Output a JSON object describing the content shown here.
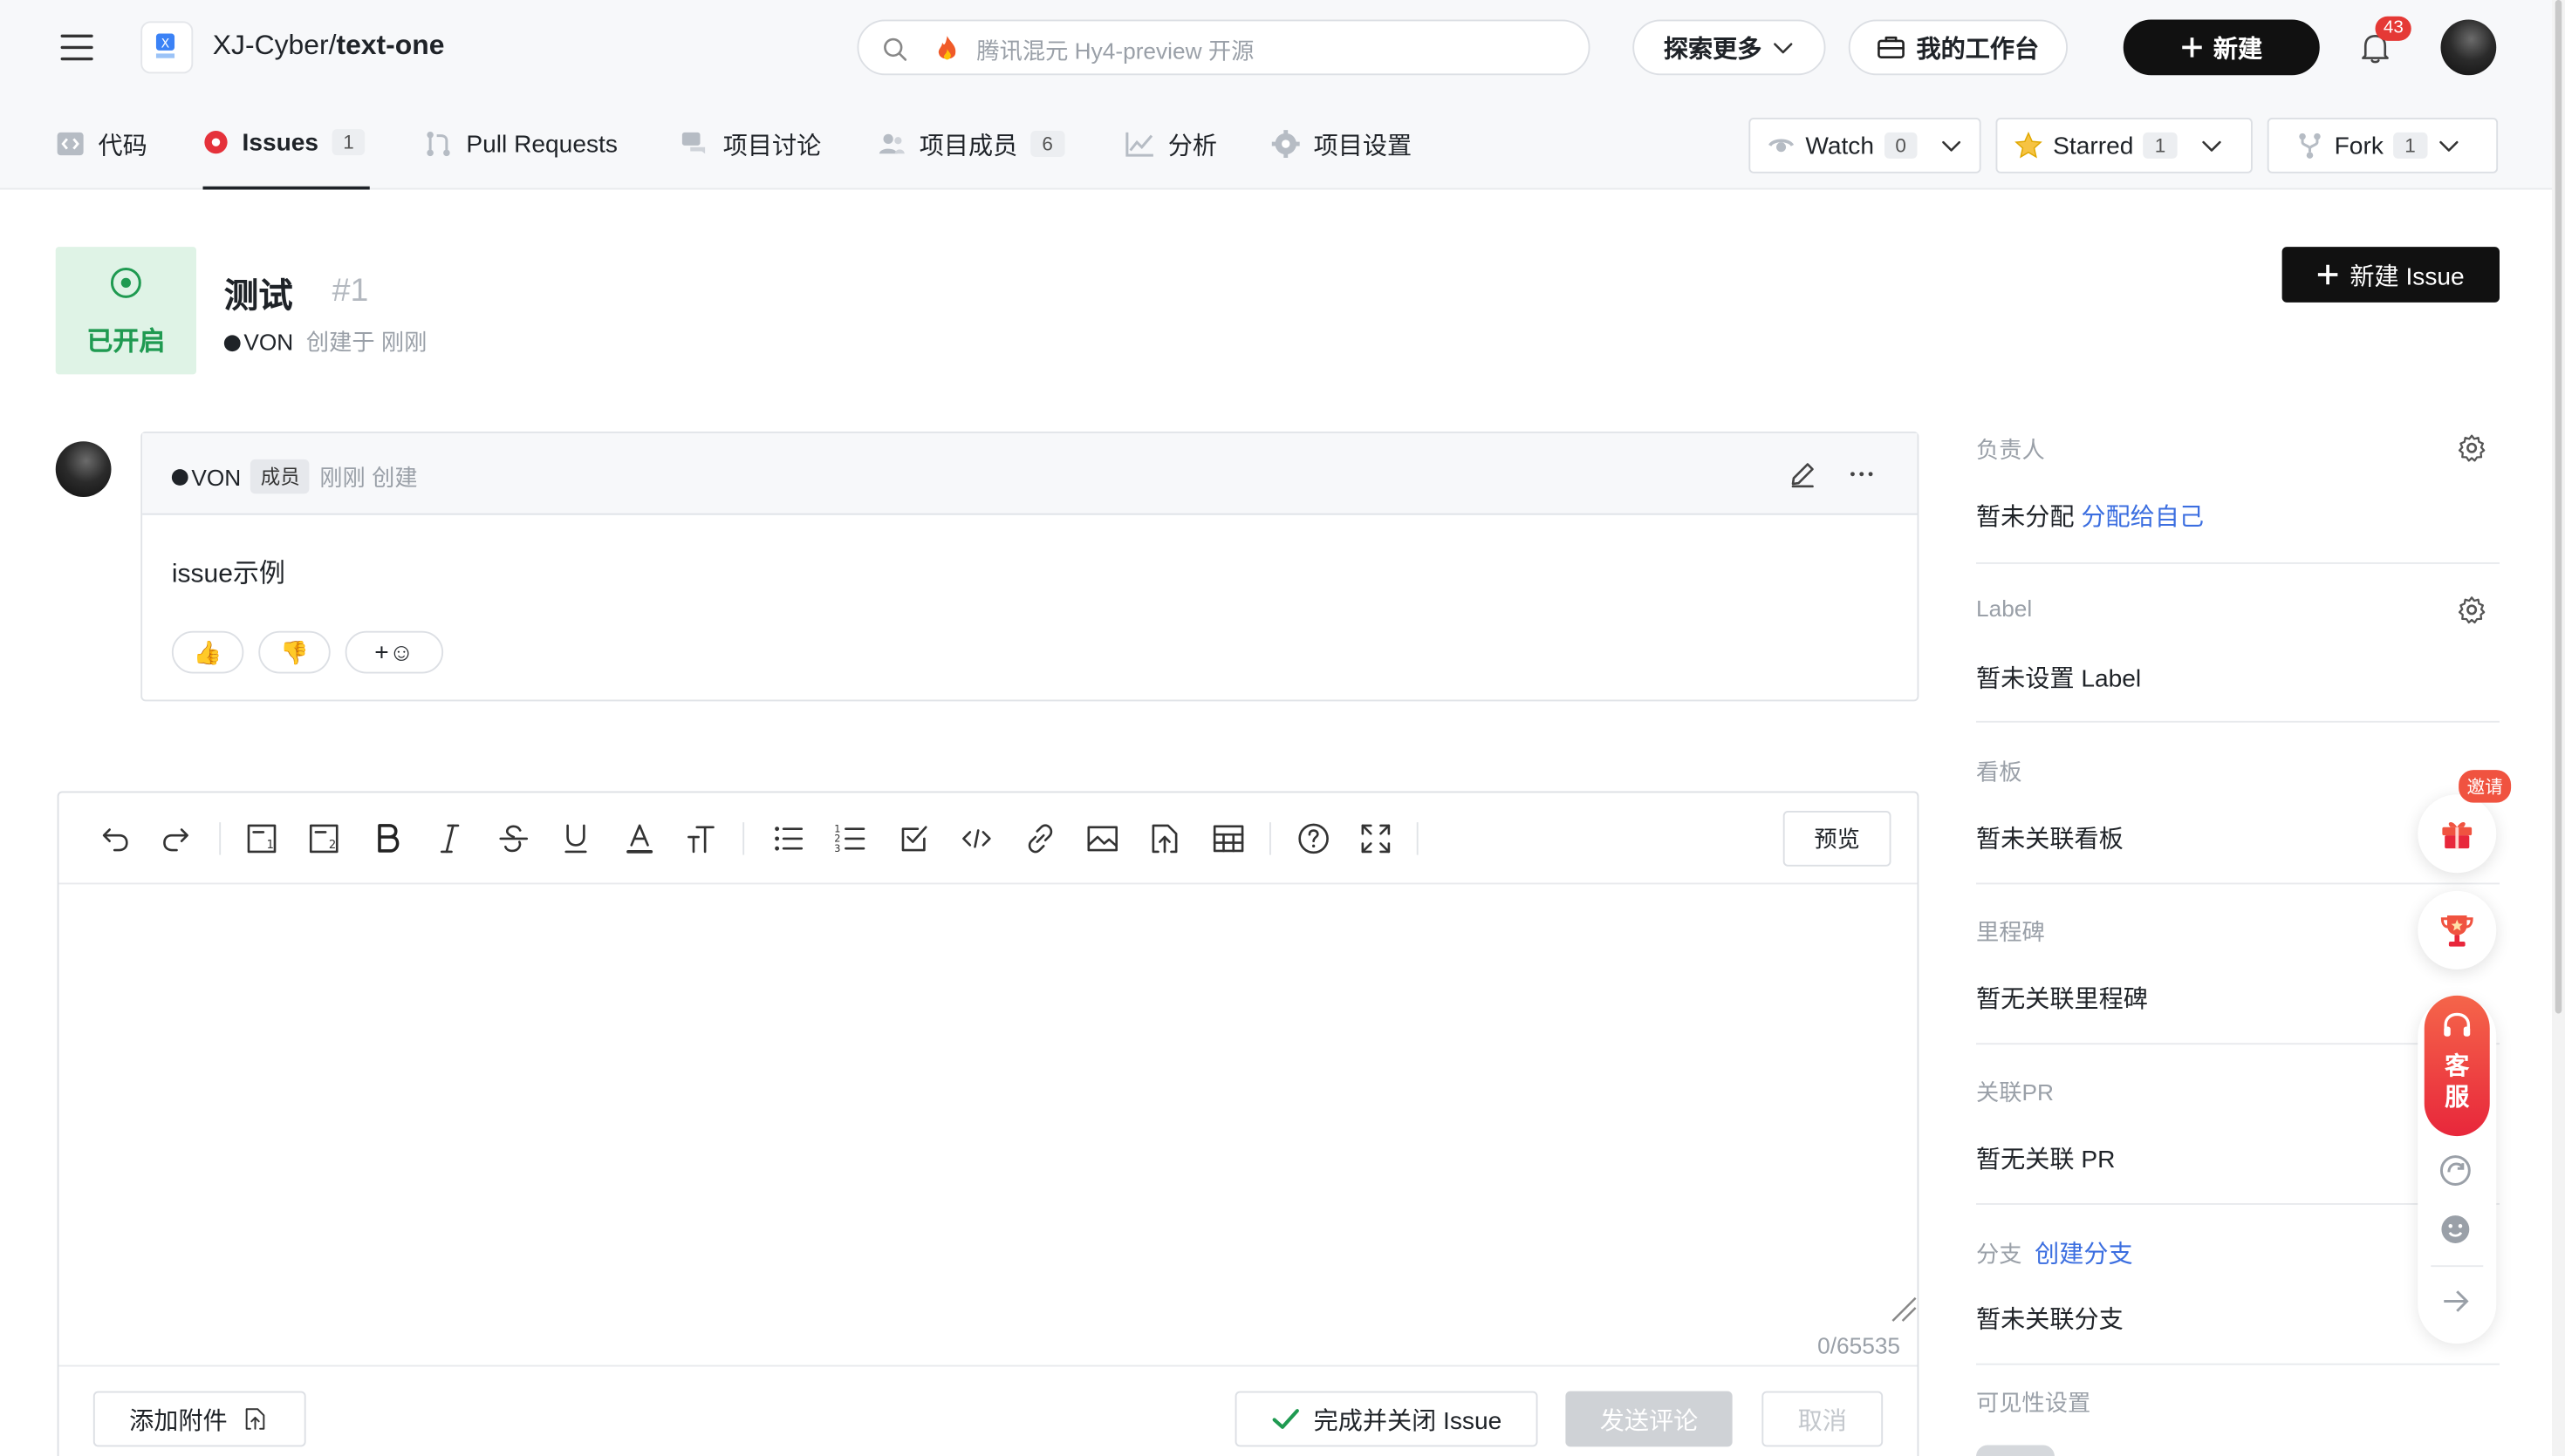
{
  "header": {
    "repo_owner": "XJ-Cyber/",
    "repo_name": "text-one",
    "search_placeholder": "腾讯混元 Hy4-preview 开源",
    "explore_more": "探索更多",
    "workbench": "我的工作台",
    "new_button": "新建",
    "notification_count": "43"
  },
  "tabs": [
    {
      "label": "代码",
      "icon": "code-icon"
    },
    {
      "label": "Issues",
      "count": "1",
      "icon": "issue-icon"
    },
    {
      "label": "Pull Requests",
      "icon": "pull-request-icon"
    },
    {
      "label": "项目讨论",
      "icon": "discussion-icon"
    },
    {
      "label": "项目成员",
      "count": "6",
      "icon": "members-icon"
    },
    {
      "label": "分析",
      "icon": "chart-icon"
    },
    {
      "label": "项目设置",
      "icon": "gear-icon"
    }
  ],
  "repo_actions": {
    "watch": {
      "label": "Watch",
      "count": "0"
    },
    "star": {
      "label": "Starred",
      "count": "1"
    },
    "fork": {
      "label": "Fork",
      "count": "1"
    }
  },
  "issue": {
    "status": "已开启",
    "title": "测试",
    "number": "#1",
    "author": "VON",
    "created_text": "创建于 刚刚",
    "new_issue_button": "新建 Issue"
  },
  "comment": {
    "author": "VON",
    "role_badge": "成员",
    "time_text": "刚刚 创建",
    "body": "issue示例",
    "reactions": [
      "👍",
      "👎",
      "+☺"
    ]
  },
  "editor": {
    "preview_button": "预览",
    "char_count": "0/65535",
    "attach_button": "添加附件",
    "close_issue_button": "完成并关闭 Issue",
    "send_comment_button": "发送评论",
    "cancel_button": "取消"
  },
  "sidebar": {
    "assignee": {
      "label": "负责人",
      "value": "暂未分配",
      "link": "分配给自己"
    },
    "label": {
      "label": "Label",
      "value": "暂未设置 Label"
    },
    "board": {
      "label": "看板",
      "value": "暂未关联看板"
    },
    "milestone": {
      "label": "里程碑",
      "value": "暂无关联里程碑"
    },
    "related_pr": {
      "label": "关联PR",
      "value": "暂无关联 PR"
    },
    "branch": {
      "label": "分支",
      "link": "创建分支",
      "value": "暂未关联分支"
    },
    "visibility": {
      "label": "可见性设置"
    }
  },
  "floating": {
    "invite_badge": "邀请",
    "service_label": "客服"
  },
  "colors": {
    "accent_link": "#3b6ee0",
    "open_status": "#1f9a51",
    "issue_red": "#e5323b",
    "primary_dark": "#111111"
  }
}
